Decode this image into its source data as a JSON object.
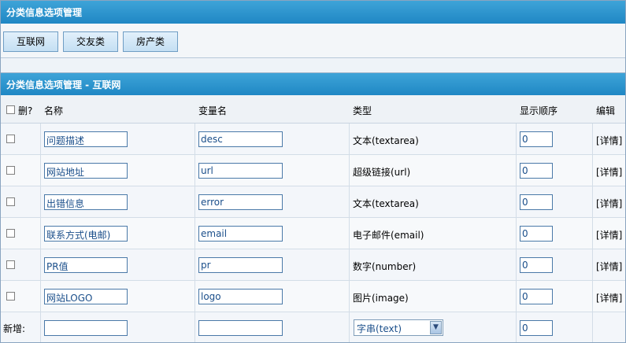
{
  "window": {
    "title": "分类信息选项管理"
  },
  "tabs": [
    {
      "label": "互联网"
    },
    {
      "label": "交友类"
    },
    {
      "label": "房产类"
    }
  ],
  "section": {
    "title": "分类信息选项管理 - 互联网"
  },
  "table": {
    "headers": {
      "delete": "删?",
      "name": "名称",
      "var_name": "变量名",
      "type": "类型",
      "order": "显示顺序",
      "edit": "编辑"
    },
    "rows": [
      {
        "name": "问题描述",
        "var": "desc",
        "type": "文本(textarea)",
        "order": "0",
        "edit": "[详情]"
      },
      {
        "name": "网站地址",
        "var": "url",
        "type": "超级链接(url)",
        "order": "0",
        "edit": "[详情]"
      },
      {
        "name": "出错信息",
        "var": "error",
        "type": "文本(textarea)",
        "order": "0",
        "edit": "[详情]"
      },
      {
        "name": "联系方式(电邮)",
        "var": "email",
        "type": "电子邮件(email)",
        "order": "0",
        "edit": "[详情]"
      },
      {
        "name": "PR值",
        "var": "pr",
        "type": "数字(number)",
        "order": "0",
        "edit": "[详情]"
      },
      {
        "name": "网站LOGO",
        "var": "logo",
        "type": "图片(image)",
        "order": "0",
        "edit": "[详情]"
      }
    ],
    "new_row": {
      "label": "新增:",
      "name": "",
      "var": "",
      "type_selected": "字串(text)",
      "order": "0"
    }
  },
  "colors": {
    "title_bar": "#2a94cf",
    "input_border": "#4a79a8",
    "input_text": "#1a4e8a"
  }
}
